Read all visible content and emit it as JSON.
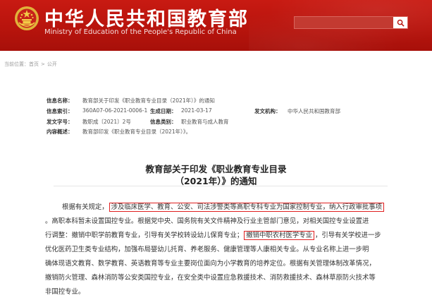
{
  "header": {
    "site_name": "中华人民共和国教育部",
    "site_name_en": "Ministry of Education of the People's Republic of China",
    "emblem_icon": "national-emblem-icon",
    "search_button_icon": "search-icon"
  },
  "breadcrumb": {
    "prefix": "当前位置：",
    "items": [
      "首页",
      "公开"
    ],
    "separator": ">"
  },
  "meta": {
    "info_name_label": "信息名称：",
    "info_name_value": "教育部关于印发《职业教育专业目录（2021年）》的通知",
    "index_label": "信息索引：",
    "index_value": "360A07-06-2021-0006-1",
    "date_label": "生成日期：",
    "date_value": "2021-03-17",
    "issuer_label": "发文机构：",
    "issuer_value": "中华人民共和国教育部",
    "doc_no_label": "发文字号：",
    "doc_no_value": "教职成〔2021〕2号",
    "category_label": "信息类别：",
    "category_value": "职业教育与成人教育",
    "summary_label": "内容概述：",
    "summary_value": "教育部印发《职业教育专业目录（2021年）》。"
  },
  "article": {
    "title_line1": "教育部关于印发《职业教育专业目录",
    "title_line2": "（2021年）》的通知",
    "lines": {
      "l1_pre": "根据有关规定，",
      "l1_hl": "涉及临床医学、教育、公安、司法涉警类等高职专科专业为国家控制专业，纳入行政审批事项",
      "l2": "。高职本科暂未设置国控专业。根据党中央、国务院有关文件精神及行业主管部门意见，对相关国控专业设置进",
      "l3_pre": "行调整：撤销中职学前教育专业，引导有关学校转设幼儿保育专业；",
      "l3_hl": "撤销中职农村医学专业",
      "l3_post": "，引导有关学校进一步",
      "l4": "优化医药卫生类专业结构，加强布局婴幼儿托育、养老服务、健康管理等人康相关专业。从专业名称上进一步明",
      "l5": "确体现语文教育、数学教育、英语教育等专业主要岗位面向为小学教育的培养定位。根据有关管理体制改革情况，",
      "l6": "撤销防火管理、森林消防等公安类国控专业，在安全类中设置应急救援技术、消防救援技术、森林草原防火技术等",
      "l7": "非国控专业。"
    }
  },
  "colors": {
    "header_red": "#b8140d",
    "highlight_border": "#e02020"
  }
}
